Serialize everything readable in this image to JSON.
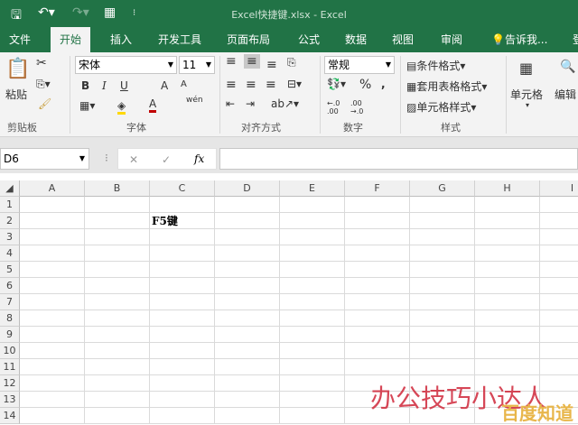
{
  "title_bar": {
    "title": "Excel快捷键.xlsx - Excel",
    "save_icon": "save-icon",
    "undo_icon": "undo-icon",
    "redo_icon": "redo-icon",
    "calc_icon": "calculator-icon"
  },
  "tabs": [
    {
      "label": "文件"
    },
    {
      "label": "开始",
      "active": true
    },
    {
      "label": "插入"
    },
    {
      "label": "开发工具"
    },
    {
      "label": "页面布局"
    },
    {
      "label": "公式"
    },
    {
      "label": "数据"
    },
    {
      "label": "视图"
    },
    {
      "label": "审阅"
    },
    {
      "label": "告诉我..."
    },
    {
      "label": "登"
    }
  ],
  "ribbon": {
    "clipboard": {
      "paste": "粘贴",
      "group": "剪贴板"
    },
    "font": {
      "name": "宋体",
      "size": "11",
      "bold": "B",
      "italic": "I",
      "underline": "U",
      "grow": "A",
      "shrink": "A",
      "color": "A",
      "phonetic": "wén",
      "group": "字体"
    },
    "align": {
      "group": "对齐方式"
    },
    "number": {
      "format": "常规",
      "percent": "%",
      "comma": ",",
      "inc": "←.0 .00",
      "dec": ".00 →.0",
      "group": "数字"
    },
    "styles": {
      "conditional": "条件格式",
      "table": "套用表格格式",
      "cell": "单元格样式",
      "group": "样式"
    },
    "cells": {
      "label": "单元格"
    },
    "edit": {
      "label": "编辑"
    }
  },
  "formula_bar": {
    "name_box": "D6",
    "cancel": "✕",
    "enter": "✓",
    "fx": "fx",
    "value": ""
  },
  "columns": [
    "A",
    "B",
    "C",
    "D",
    "E",
    "F",
    "G",
    "H",
    "I"
  ],
  "rows": [
    "1",
    "2",
    "3",
    "4",
    "5",
    "6",
    "7",
    "8",
    "9",
    "10",
    "11",
    "12",
    "13",
    "14"
  ],
  "cells": {
    "C2": "F5键"
  },
  "watermark": {
    "text": "办公技巧小达人",
    "brand": "百度知道"
  },
  "colors": {
    "accent": "#217346"
  }
}
